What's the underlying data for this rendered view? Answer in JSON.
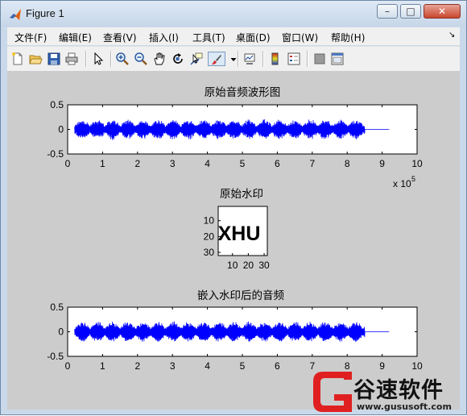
{
  "window": {
    "title": "Figure 1",
    "buttons": [
      "–",
      "□",
      "✕"
    ]
  },
  "menu": {
    "items": [
      "文件(F)",
      "编辑(E)",
      "查看(V)",
      "插入(I)",
      "工具(T)",
      "桌面(D)",
      "窗口(W)",
      "帮助(H)"
    ],
    "dock_glyph": "↘"
  },
  "toolbar": {
    "icons": [
      "new-file-icon",
      "open-folder-icon",
      "save-icon",
      "print-icon",
      "arrow-pointer-icon",
      "zoom-in-icon",
      "zoom-out-icon",
      "pan-hand-icon",
      "rotate-3d-icon",
      "data-cursor-icon",
      "brush-icon",
      "brush-dropdown-icon",
      "link-plot-icon",
      "colorbar-icon",
      "legend-icon",
      "hide-plot-tools-icon",
      "show-plot-tools-icon"
    ]
  },
  "figure": {
    "background": "#cccccc",
    "line_color": "#0000ff",
    "axes": [
      {
        "title": "原始音频波形图",
        "x_ticks": [
          "0",
          "1",
          "2",
          "3",
          "4",
          "5",
          "6",
          "7",
          "8",
          "9",
          "10"
        ],
        "y_ticks": [
          "0.5",
          "0",
          "-0.5"
        ],
        "x_multiplier_base": "x 10",
        "x_multiplier_exp": "5"
      },
      {
        "title": "原始水印",
        "x_ticks": [
          "10",
          "20",
          "30"
        ],
        "y_ticks": [
          "10",
          "20",
          "30"
        ],
        "image_text": "XHU"
      },
      {
        "title": "嵌入水印后的音频",
        "x_ticks": [
          "0",
          "1",
          "2",
          "3",
          "4",
          "5",
          "6",
          "7",
          "8",
          "9",
          "10"
        ],
        "y_ticks": [
          "0.5",
          "0",
          "-0.5"
        ]
      }
    ]
  },
  "chart_data": [
    {
      "type": "line",
      "title": "原始音频波形图",
      "xlim": [
        0,
        1000000
      ],
      "ylim": [
        -0.5,
        0.5
      ],
      "x_scale_multiplier": 100000,
      "signal_extent": [
        20000,
        920000
      ],
      "active_audio_end": 850000,
      "approx_peak_amplitude": 0.22,
      "grid": false
    },
    {
      "type": "heatmap",
      "title": "原始水印",
      "xlim": [
        1,
        32
      ],
      "ylim": [
        1,
        32
      ],
      "content_text": "XHU",
      "colormap": "gray"
    },
    {
      "type": "line",
      "title": "嵌入水印后的音频",
      "xlim": [
        0,
        1000000
      ],
      "ylim": [
        -0.5,
        0.5
      ],
      "x_scale_multiplier": 100000,
      "signal_extent": [
        20000,
        920000
      ],
      "active_audio_end": 850000,
      "approx_peak_amplitude": 0.22,
      "grid": false
    }
  ],
  "watermark": {
    "brand_text": "谷速软件",
    "url": "www.gususoft.com",
    "brand_color": "#e02020"
  }
}
